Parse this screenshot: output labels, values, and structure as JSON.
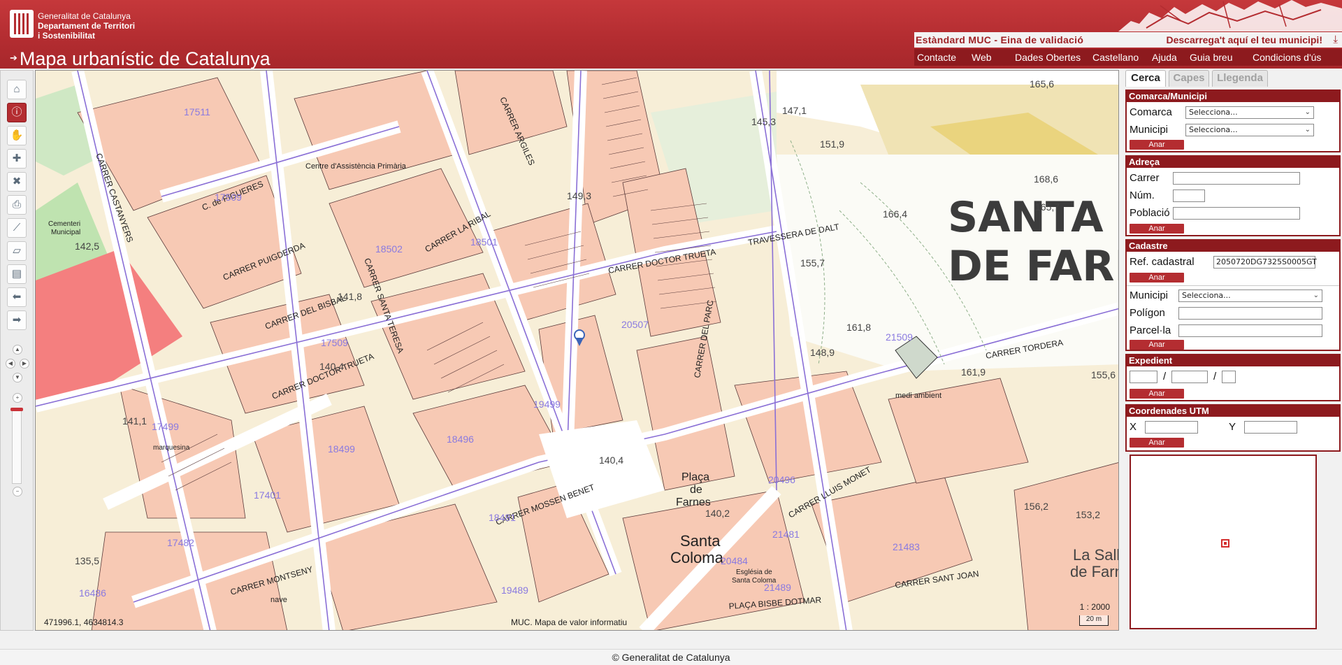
{
  "header": {
    "org_line1": "Generalitat de Catalunya",
    "org_line2": "Departament de Territori",
    "org_line3": "i Sostenibilitat",
    "app_title": "Mapa urbanístic de Catalunya",
    "banner_left": "Estàndard MUC - Eina de validació",
    "banner_right": "Descarrega't aquí el teu municipi!",
    "nav": [
      "Contacte",
      "Web",
      "Dades Obertes",
      "Castellano",
      "Ajuda",
      "Guia breu",
      "Condicions d'ús"
    ]
  },
  "toolbar": {
    "tools": [
      "home-icon",
      "info-icon",
      "hand-pan-icon",
      "layer-add-icon",
      "layer-remove-icon",
      "print-icon",
      "measure-line-icon",
      "measure-area-icon",
      "map-export-icon",
      "back-arrow-icon",
      "forward-arrow-icon"
    ],
    "active_tool": "info-icon"
  },
  "map": {
    "coords": "471996.1, 4634814.3",
    "credit": "MUC. Mapa de valor informatiu",
    "scale": "1 : 2000",
    "scale_bar": "20 m",
    "town_title_line1": "SANTA CO",
    "town_title_line2": "DE FARN",
    "labels": {
      "placa_line1": "Plaça",
      "placa_line2": "de",
      "placa_line3": "Farnes",
      "santa": "Santa",
      "coloma": "Coloma",
      "centre": "Centre d'Assistència Primària",
      "cementiri1": "Cementeri",
      "cementiri2": "Municipal",
      "marquesina": "marquesina",
      "esglesia1": "Església de",
      "esglesia2": "Santa Coloma",
      "medi": "medi ambient",
      "nave": "nave",
      "lasalle1": "La Salle",
      "lasalle2": "de Farn"
    },
    "streets": [
      "C. de FIGUERES",
      "CARRER PUIGDERDA",
      "CARRER LA RIBAL",
      "CARRER DOCTOR TRUETA",
      "TRAVESSERA DE DALT",
      "CARRER SANTA TERESA",
      "CARRER DEL PARC",
      "CARRER TORDERA",
      "CARRER DOCTOR TRUETA",
      "CARRER MOSSEN BENET",
      "CARRER SANT JOAN",
      "PLAÇA BISBE DOTMAR",
      "CARRER MONTSENY",
      "CARRER CASTANYERS",
      "CARRER LLUIS MONET",
      "CARRER ARGILES",
      "CARRER DEL BISBAL"
    ],
    "parcel_numbers": [
      "17511",
      "17509",
      "18502",
      "18501",
      "17509",
      "20507",
      "21509",
      "17499",
      "18499",
      "19499",
      "17401",
      "17482",
      "16486",
      "18481",
      "19489",
      "20484",
      "21481",
      "21483",
      "18496",
      "20496",
      "21489"
    ],
    "elevations": [
      "165,6",
      "147,1",
      "151,9",
      "145,3",
      "166,4",
      "165,7",
      "168,6",
      "149,3",
      "141,8",
      "140,4",
      "161,8",
      "161,9",
      "140,2",
      "140,4",
      "141,1",
      "135,5",
      "142,5",
      "148,9",
      "155,6",
      "153,2",
      "156,2",
      "155,7"
    ]
  },
  "panel": {
    "tabs": [
      "Cerca",
      "Capes",
      "Llegenda"
    ],
    "sections": {
      "comarca": {
        "title": "Comarca/Municipi",
        "comarca_label": "Comarca",
        "comarca_value": "Selecciona...",
        "municipi_label": "Municipi",
        "municipi_value": "Selecciona...",
        "go": "Anar"
      },
      "adreca": {
        "title": "Adreça",
        "carrer_label": "Carrer",
        "num_label": "Núm.",
        "poblacio_label": "Població",
        "go": "Anar"
      },
      "cadastre": {
        "title": "Cadastre",
        "ref_label": "Ref. cadastral",
        "ref_value": "2050720DG7325S0005GT",
        "go1": "Anar",
        "municipi_label": "Municipi",
        "municipi_value": "Selecciona...",
        "poligon_label": "Polígon",
        "parcela_label": "Parcel·la",
        "go2": "Anar"
      },
      "expedient": {
        "title": "Expedient",
        "sep1": "/",
        "sep2": "/",
        "go": "Anar"
      },
      "utm": {
        "title": "Coordenades UTM",
        "x_label": "X",
        "y_label": "Y",
        "go": "Anar"
      }
    }
  },
  "footer": {
    "text": "© Generalitat de Catalunya"
  }
}
